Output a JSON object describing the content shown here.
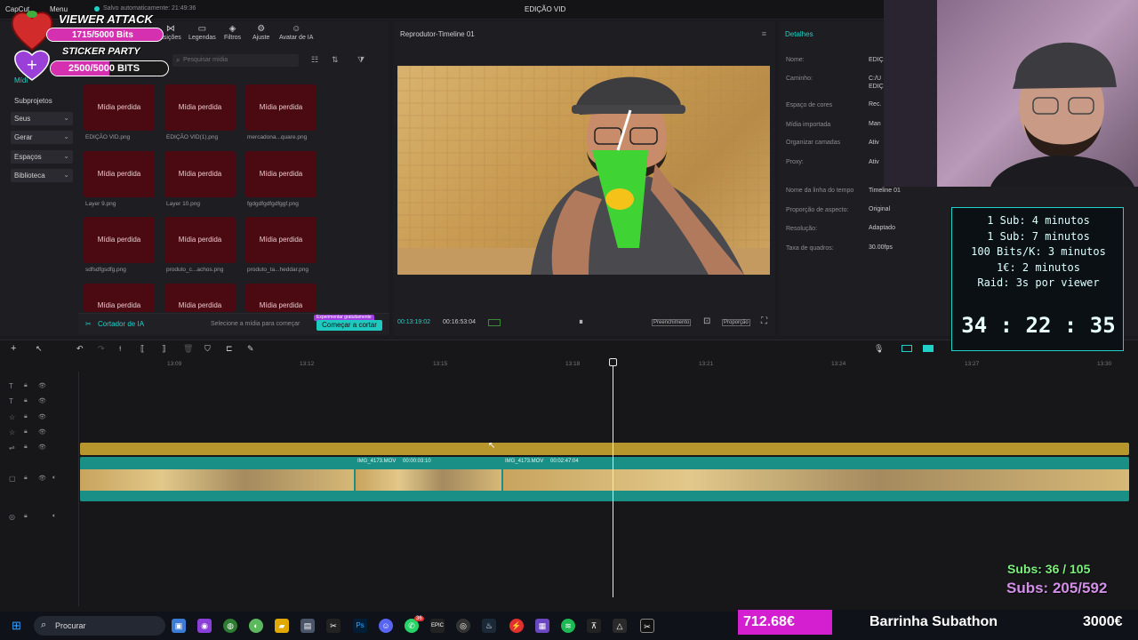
{
  "app": {
    "logo": "CapCut",
    "menu": "Menu",
    "autosave": "Salvo automaticamente: 21:49:36",
    "title": "EDIÇÃO VID"
  },
  "toolbar": {
    "items": [
      {
        "label": "nsições",
        "icon": "transitions-icon"
      },
      {
        "label": "Legendas",
        "icon": "captions-icon"
      },
      {
        "label": "Filtros",
        "icon": "filters-icon"
      },
      {
        "label": "Ajuste",
        "icon": "adjust-icon"
      },
      {
        "label": "Avatar de IA",
        "icon": "avatar-icon"
      }
    ]
  },
  "media": {
    "search_placeholder": "Pesquisar mídia",
    "sidebar": {
      "midia": "Mídi",
      "subprojetos": "Subprojetos",
      "seus": "Seus",
      "gerar": "Gerar",
      "espacos": "Espaços",
      "biblioteca": "Biblioteca"
    },
    "tile_label": "Mídia perdida",
    "files": [
      "EDIÇÃO VID.png",
      "EDIÇÃO VID(1).png",
      "mercadona...quare.png",
      "Layer 9.png",
      "Layer 10.png",
      "fgdgdfgdfgdfggf.png",
      "sdfsdfgsdfg.png",
      "produto_c...achos.png",
      "produto_ta...heddar.png"
    ],
    "footer": {
      "ai_cutter": "Cortador de IA",
      "hint": "Selecione a mídia para começar",
      "badge": "Experimentar gratuitamente",
      "cta": "Começar a cortar"
    }
  },
  "preview": {
    "title": "Reprodutor-Timeline 01",
    "current_time": "00:13:19:02",
    "total_time": "00:16:53:04",
    "fill_label": "Preenchimento",
    "ratio_label": "Proporção"
  },
  "details": {
    "tab": "Detalhes",
    "rows": [
      {
        "label": "Nome:",
        "value": "EDIÇ"
      },
      {
        "label": "Caminho:",
        "value": "C:/U"
      },
      {
        "label": "",
        "value": "EDIÇ"
      },
      {
        "label": "Espaço de cores",
        "value": "Rec."
      },
      {
        "label": "Mídia importada",
        "value": "Man"
      },
      {
        "label": "Organizar camadas",
        "value": "Ativ"
      },
      {
        "label": "Proxy:",
        "value": "Ativ"
      },
      {
        "label": "Nome da linha do tempo",
        "value": "Timeline 01"
      },
      {
        "label": "Proporção de aspecto:",
        "value": "Original"
      },
      {
        "label": "Resolução:",
        "value": "Adaptado"
      },
      {
        "label": "Taxa de quadros:",
        "value": "30.00fps"
      }
    ]
  },
  "timeline": {
    "ticks": [
      "13:09",
      "13:12",
      "13:15",
      "13:18",
      "13:21",
      "13:24",
      "13:27",
      "13:30"
    ],
    "clips": [
      {
        "name": "IMG_4173.MOV",
        "duration": "00:00:03:10"
      },
      {
        "name": "IMG_4173.MOV",
        "duration": "00:02:47:04"
      }
    ]
  },
  "overlay": {
    "viewer_attack": "VIEWER ATTACK",
    "bits1": "1715/5000 Bits",
    "sticker_party": "STICKER PARTY",
    "bits2": "2500/5000 BITS",
    "rules": [
      "1 Sub: 4 minutos",
      "1 Sub: 7 minutos",
      "100 Bits/K: 3 minutos",
      "1€: 2 minutos",
      "Raid: 3s por viewer"
    ],
    "timer": "34 : 22 : 35",
    "subs1": "Subs: 36 / 105",
    "subs2": "Subs: 205/592",
    "donation": "712.68€",
    "bar_title": "Barrinha Subathon",
    "goal": "3000€"
  },
  "taskbar": {
    "search": "Procurar",
    "badge_count": "36"
  },
  "colors": {
    "accent_teal": "#1fd1c7",
    "media_tile": "#4b0a12",
    "cta_teal": "#1ec9c0",
    "clip_teal": "#1a8f86",
    "audio_gold": "#b8962e",
    "donation_pink": "#d31fd0"
  }
}
